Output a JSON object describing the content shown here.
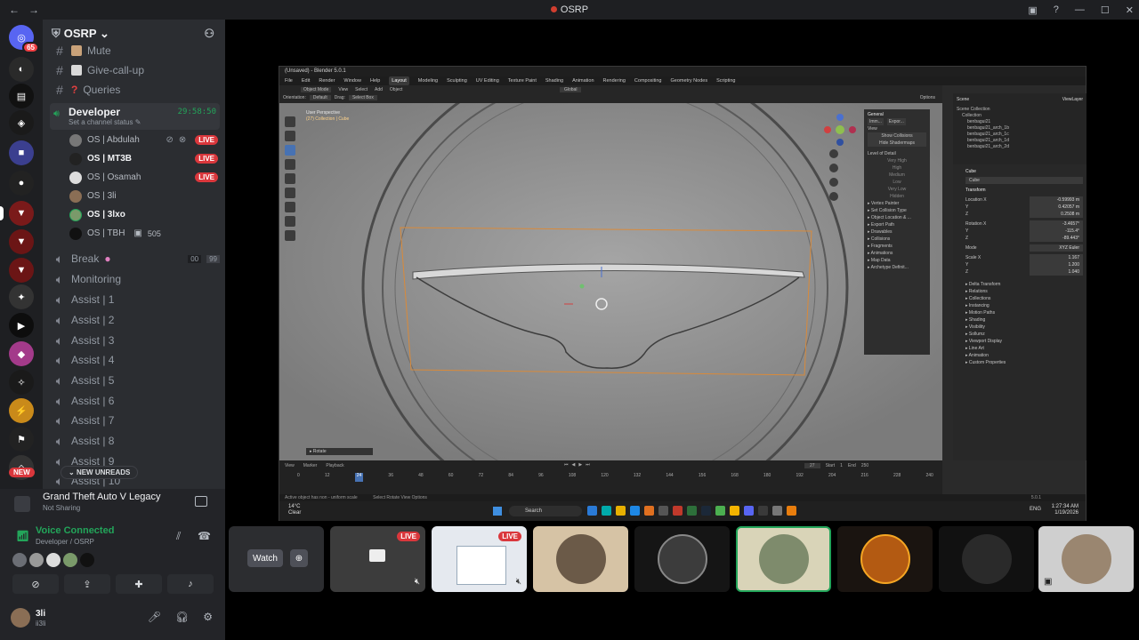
{
  "window": {
    "title": "OSRP"
  },
  "server": {
    "name": "OSRP",
    "guild_badge": "65"
  },
  "channels": [
    {
      "name": "Mute",
      "type": "text"
    },
    {
      "name": "Give-call-up",
      "type": "text"
    },
    {
      "name": "Queries",
      "type": "text"
    }
  ],
  "active_voice": {
    "name": "Developer",
    "status": "Set a channel status",
    "timer": "29:58:50",
    "users": [
      {
        "name": "OS | Abdulah",
        "live": "LIVE"
      },
      {
        "name": "OS | MT3B",
        "live": "LIVE"
      },
      {
        "name": "OS | Osamah",
        "live": "LIVE"
      },
      {
        "name": "OS | 3li",
        "live": ""
      },
      {
        "name": "OS | 3lxo",
        "live": ""
      },
      {
        "name": "OS | TBH",
        "live": "",
        "extra": "505"
      }
    ]
  },
  "voice_channels": [
    {
      "name": "Break",
      "count_a": "00",
      "count_b": "99"
    },
    {
      "name": "Monitoring"
    },
    {
      "name": "Assist | 1"
    },
    {
      "name": "Assist | 2"
    },
    {
      "name": "Assist | 3"
    },
    {
      "name": "Assist | 4"
    },
    {
      "name": "Assist | 5"
    },
    {
      "name": "Assist | 6"
    },
    {
      "name": "Assist | 7"
    },
    {
      "name": "Assist | 8"
    },
    {
      "name": "Assist | 9"
    },
    {
      "name": "Assist | 10"
    }
  ],
  "new_unreads": "NEW UNREADS",
  "new_badge": "NEW",
  "activity": {
    "game": "Grand Theft Auto V Legacy",
    "status": "Not Sharing"
  },
  "voice_connected": {
    "title": "Voice Connected",
    "location": "Developer / OSRP"
  },
  "user": {
    "name": "3li",
    "tag": "ii3li"
  },
  "blender": {
    "title": "(Unsaved) - Blender 5.0.1",
    "menu": [
      "File",
      "Edit",
      "Render",
      "Window",
      "Help"
    ],
    "workspaces": [
      "Layout",
      "Modeling",
      "Sculpting",
      "UV Editing",
      "Texture Paint",
      "Shading",
      "Animation",
      "Rendering",
      "Compositing",
      "Geometry Nodes",
      "Scripting"
    ],
    "active_workspace": "Layout",
    "mode": "Object Mode",
    "header_menu": [
      "View",
      "Select",
      "Add",
      "Object"
    ],
    "orientation": "Orientation:",
    "orientation_value": "Default",
    "drag": "Drag:",
    "drag_value": "Select Box",
    "transform_space": "Global",
    "options": "Options",
    "viewport_label_1": "User Perspective",
    "viewport_label_2": "(27) Collection | Cube",
    "npanel": {
      "header": "General",
      "items": [
        "Imm...",
        "Expor...",
        "View",
        "Show Collisions",
        "Hide Shadermaps",
        "Level of Detail",
        "Very High",
        "High",
        "Medium",
        "Low",
        "Very Low",
        "Hidden",
        "Vertex Painter",
        "Set Collision Type",
        "Object Location & ...",
        "Export Path",
        "Drawables",
        "Collisions",
        "Fragments",
        "Animations",
        "Map Data",
        "Archetype Definit..."
      ]
    },
    "outliner": {
      "header": "Scene",
      "view_layer": "ViewLayer",
      "items": [
        "Scene Collection",
        "Collection",
        "benbagui21",
        "benbagui21_arch_1b",
        "benbagui21_arch_1c",
        "benbagui21_arch_1d",
        "benbagui21_arch_2d"
      ]
    },
    "properties": {
      "object": "Cube",
      "mesh": "Cube",
      "section": "Transform",
      "fields": [
        {
          "label": "Location X",
          "value": "-0.59993 m"
        },
        {
          "label": "Y",
          "value": "0.42057 m"
        },
        {
          "label": "Z",
          "value": "0.2508 m"
        },
        {
          "label": "Rotation X",
          "value": "-3.4657°"
        },
        {
          "label": "Y",
          "value": "-115.4°"
        },
        {
          "label": "Z",
          "value": "-89.443°"
        },
        {
          "label": "Mode",
          "value": "XYZ Euler"
        },
        {
          "label": "Scale X",
          "value": "1.167"
        },
        {
          "label": "Y",
          "value": "1.200"
        },
        {
          "label": "Z",
          "value": "1.040"
        }
      ],
      "sections": [
        "Delta Transform",
        "Relations",
        "Collections",
        "Instancing",
        "Motion Paths",
        "Shading",
        "Visibility",
        "Sollumz",
        "Viewport Display",
        "Line Art",
        "Animation",
        "Custom Properties"
      ]
    },
    "timeline": {
      "menus": [
        "View",
        "Marker",
        "Playback"
      ],
      "current": "27",
      "start_label": "Start",
      "start": "1",
      "end_label": "End",
      "end": "250",
      "ticks": [
        "0",
        "12",
        "24",
        "36",
        "48",
        "60",
        "72",
        "84",
        "96",
        "108",
        "120",
        "132",
        "144",
        "156",
        "168",
        "180",
        "192",
        "204",
        "216",
        "228",
        "240"
      ]
    },
    "status": "Active object has non - uniform scale",
    "status_right": "Select  Rotate View  Options",
    "operator": "Rotate",
    "version": "5.0.1"
  },
  "taskbar": {
    "weather_temp": "14°C",
    "weather_desc": "Clear",
    "search": "Search",
    "lang": "ENG",
    "time": "1:27:34 AM",
    "date": "1/19/2026"
  },
  "stream_strip": {
    "watch": "Watch",
    "tiles": [
      {
        "live": "LIVE"
      },
      {
        "live": "LIVE"
      },
      {
        "live": ""
      },
      {
        "live": ""
      },
      {
        "live": ""
      },
      {
        "live": ""
      },
      {
        "live": ""
      },
      {
        "live": ""
      }
    ]
  },
  "colors": {
    "accent_green": "#23a55a",
    "live_red": "#da373c",
    "sidebar_bg": "#2b2d31"
  }
}
